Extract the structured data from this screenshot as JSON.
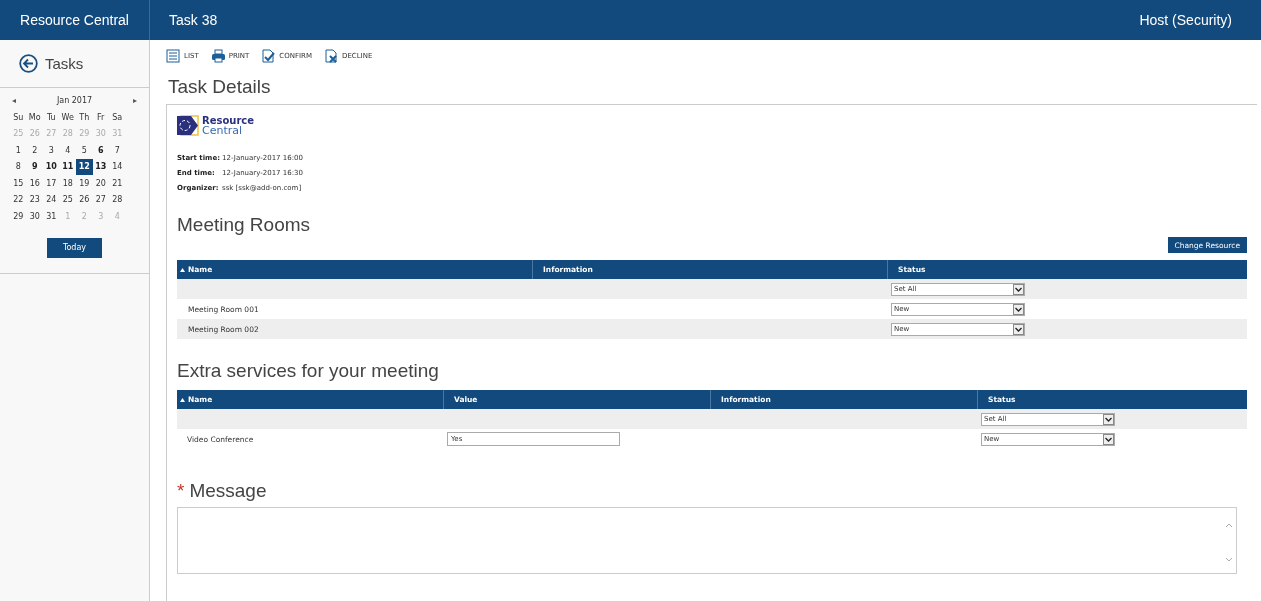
{
  "header": {
    "app_title": "Resource Central",
    "page_title": "Task 38",
    "user": "Host (Security)"
  },
  "sidebar": {
    "back_label": "Tasks",
    "calendar": {
      "month": "Jan 2017",
      "prev": "◂",
      "next": "▸",
      "weekdays": [
        "Su",
        "Mo",
        "Tu",
        "We",
        "Th",
        "Fr",
        "Sa"
      ],
      "weeks": [
        [
          {
            "day": "25",
            "muted": true,
            "bold": false,
            "selected": false
          },
          {
            "day": "26",
            "muted": true,
            "bold": false,
            "selected": false
          },
          {
            "day": "27",
            "muted": true,
            "bold": false,
            "selected": false
          },
          {
            "day": "28",
            "muted": true,
            "bold": false,
            "selected": false
          },
          {
            "day": "29",
            "muted": true,
            "bold": false,
            "selected": false
          },
          {
            "day": "30",
            "muted": true,
            "bold": false,
            "selected": false
          },
          {
            "day": "31",
            "muted": true,
            "bold": false,
            "selected": false
          }
        ],
        [
          {
            "day": "1",
            "muted": false,
            "bold": false,
            "selected": false
          },
          {
            "day": "2",
            "muted": false,
            "bold": false,
            "selected": false
          },
          {
            "day": "3",
            "muted": false,
            "bold": false,
            "selected": false
          },
          {
            "day": "4",
            "muted": false,
            "bold": false,
            "selected": false
          },
          {
            "day": "5",
            "muted": false,
            "bold": false,
            "selected": false
          },
          {
            "day": "6",
            "muted": false,
            "bold": true,
            "selected": false
          },
          {
            "day": "7",
            "muted": false,
            "bold": false,
            "selected": false
          }
        ],
        [
          {
            "day": "8",
            "muted": false,
            "bold": false,
            "selected": false
          },
          {
            "day": "9",
            "muted": false,
            "bold": true,
            "selected": false
          },
          {
            "day": "10",
            "muted": false,
            "bold": true,
            "selected": false
          },
          {
            "day": "11",
            "muted": false,
            "bold": true,
            "selected": false
          },
          {
            "day": "12",
            "muted": false,
            "bold": true,
            "selected": true
          },
          {
            "day": "13",
            "muted": false,
            "bold": true,
            "selected": false
          },
          {
            "day": "14",
            "muted": false,
            "bold": false,
            "selected": false
          }
        ],
        [
          {
            "day": "15",
            "muted": false,
            "bold": false,
            "selected": false
          },
          {
            "day": "16",
            "muted": false,
            "bold": false,
            "selected": false
          },
          {
            "day": "17",
            "muted": false,
            "bold": false,
            "selected": false
          },
          {
            "day": "18",
            "muted": false,
            "bold": false,
            "selected": false
          },
          {
            "day": "19",
            "muted": false,
            "bold": false,
            "selected": false
          },
          {
            "day": "20",
            "muted": false,
            "bold": false,
            "selected": false
          },
          {
            "day": "21",
            "muted": false,
            "bold": false,
            "selected": false
          }
        ],
        [
          {
            "day": "22",
            "muted": false,
            "bold": false,
            "selected": false
          },
          {
            "day": "23",
            "muted": false,
            "bold": false,
            "selected": false
          },
          {
            "day": "24",
            "muted": false,
            "bold": false,
            "selected": false
          },
          {
            "day": "25",
            "muted": false,
            "bold": false,
            "selected": false
          },
          {
            "day": "26",
            "muted": false,
            "bold": false,
            "selected": false
          },
          {
            "day": "27",
            "muted": false,
            "bold": false,
            "selected": false
          },
          {
            "day": "28",
            "muted": false,
            "bold": false,
            "selected": false
          }
        ],
        [
          {
            "day": "29",
            "muted": false,
            "bold": false,
            "selected": false
          },
          {
            "day": "30",
            "muted": false,
            "bold": false,
            "selected": false
          },
          {
            "day": "31",
            "muted": false,
            "bold": false,
            "selected": false
          },
          {
            "day": "1",
            "muted": true,
            "bold": false,
            "selected": false
          },
          {
            "day": "2",
            "muted": true,
            "bold": false,
            "selected": false
          },
          {
            "day": "3",
            "muted": true,
            "bold": false,
            "selected": false
          },
          {
            "day": "4",
            "muted": true,
            "bold": false,
            "selected": false
          }
        ]
      ]
    },
    "today_button": "Today"
  },
  "toolbar": [
    {
      "kind": "list",
      "label": "LIST"
    },
    {
      "kind": "print",
      "label": "PRINT"
    },
    {
      "kind": "confirm",
      "label": "CONFIRM"
    },
    {
      "kind": "decline",
      "label": "DECLINE"
    }
  ],
  "title": "Task Details",
  "logo": {
    "line1": "Resource",
    "line2": "Central"
  },
  "details": [
    {
      "label": "Start time:",
      "value": "12-January-2017  16:00"
    },
    {
      "label": "End time:",
      "value": "12-January-2017  16:30"
    },
    {
      "label": "Organizer:",
      "value": "ssk [ssk@add-on.com]"
    }
  ],
  "rooms": {
    "heading": "Meeting Rooms",
    "button": "Change Resource",
    "columns": [
      {
        "kind": "name",
        "label": "Name",
        "sorted": true
      },
      {
        "kind": "info",
        "label": "Information",
        "sorted": false
      },
      {
        "kind": "status",
        "label": "Status",
        "sorted": false
      }
    ],
    "rows": [
      {
        "status": "Set All"
      },
      {
        "name": "Meeting Room 001",
        "status": "New"
      },
      {
        "name": "Meeting Room 002",
        "status": "New"
      }
    ]
  },
  "services": {
    "heading": "Extra services for your meeting",
    "columns": [
      {
        "kind": "name",
        "label": "Name",
        "sorted": true
      },
      {
        "kind": "value",
        "label": "Value",
        "sorted": false
      },
      {
        "kind": "info",
        "label": "Information",
        "sorted": false
      },
      {
        "kind": "status",
        "label": "Status",
        "sorted": false
      }
    ],
    "rows": [
      {
        "status": "Set All"
      },
      {
        "name": "Video Conference",
        "value": "Yes",
        "status": "New"
      }
    ]
  },
  "message": {
    "required_mark": "*",
    "label": "Message"
  }
}
